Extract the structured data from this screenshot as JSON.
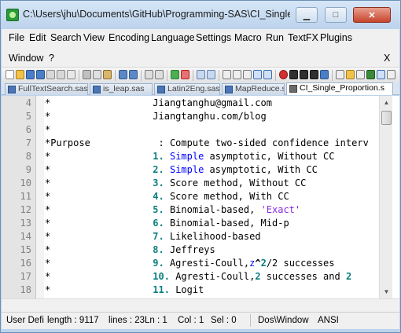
{
  "window": {
    "title": "C:\\Users\\jhu\\Documents\\GitHub\\Programming-SAS\\CI_Single_Propo...",
    "minimize_glyph": "▁",
    "maximize_glyph": "□",
    "close_glyph": "✕"
  },
  "menu": {
    "row1": [
      "File",
      "Edit",
      "Search",
      "View",
      "Encoding",
      "Language",
      "Settings",
      "Macro",
      "Run",
      "TextFX",
      "Plugins"
    ],
    "row2": [
      "Window",
      "?"
    ],
    "close_doc": "X"
  },
  "tabs": [
    {
      "label": "FullTextSearch.sas",
      "active": false
    },
    {
      "label": "is_leap.sas",
      "active": false
    },
    {
      "label": "Latin2Eng.sas",
      "active": false
    },
    {
      "label": "MapReduce.sas",
      "active": false
    },
    {
      "label": "CI_Single_Proportion.s",
      "active": true
    }
  ],
  "editor": {
    "lines": [
      {
        "n": "4",
        "segments": [
          {
            "t": "*                  Jiangtanghu@gmail.com",
            "c": ""
          }
        ]
      },
      {
        "n": "5",
        "segments": [
          {
            "t": "*                  Jiangtanghu.com/blog",
            "c": ""
          }
        ]
      },
      {
        "n": "6",
        "segments": [
          {
            "t": "*",
            "c": ""
          }
        ]
      },
      {
        "n": "7",
        "segments": [
          {
            "t": "*Purpose            : Compute two-sided confidence interv",
            "c": ""
          }
        ]
      },
      {
        "n": "8",
        "segments": [
          {
            "t": "*                  ",
            "c": ""
          },
          {
            "t": "1.",
            "c": "num"
          },
          {
            "t": " ",
            "c": ""
          },
          {
            "t": "Simple",
            "c": "kw"
          },
          {
            "t": " asymptotic, Without CC",
            "c": ""
          }
        ]
      },
      {
        "n": "9",
        "segments": [
          {
            "t": "*                  ",
            "c": ""
          },
          {
            "t": "2.",
            "c": "num"
          },
          {
            "t": " ",
            "c": ""
          },
          {
            "t": "Simple",
            "c": "kw"
          },
          {
            "t": " asymptotic, With CC",
            "c": ""
          }
        ]
      },
      {
        "n": "10",
        "segments": [
          {
            "t": "*                  ",
            "c": ""
          },
          {
            "t": "3.",
            "c": "num"
          },
          {
            "t": " Score method, Without CC",
            "c": ""
          }
        ]
      },
      {
        "n": "11",
        "segments": [
          {
            "t": "*                  ",
            "c": ""
          },
          {
            "t": "4.",
            "c": "num"
          },
          {
            "t": " Score method, With CC",
            "c": ""
          }
        ]
      },
      {
        "n": "12",
        "segments": [
          {
            "t": "*                  ",
            "c": ""
          },
          {
            "t": "5.",
            "c": "num"
          },
          {
            "t": " Binomial-based, ",
            "c": ""
          },
          {
            "t": "'Exact'",
            "c": "str"
          }
        ]
      },
      {
        "n": "13",
        "segments": [
          {
            "t": "*                  ",
            "c": ""
          },
          {
            "t": "6.",
            "c": "num"
          },
          {
            "t": " Binomial-based, Mid-p",
            "c": ""
          }
        ]
      },
      {
        "n": "14",
        "segments": [
          {
            "t": "*                  ",
            "c": ""
          },
          {
            "t": "7.",
            "c": "num"
          },
          {
            "t": " Likelihood-based",
            "c": ""
          }
        ]
      },
      {
        "n": "15",
        "segments": [
          {
            "t": "*                  ",
            "c": ""
          },
          {
            "t": "8.",
            "c": "num"
          },
          {
            "t": " Jeffreys",
            "c": ""
          }
        ]
      },
      {
        "n": "16",
        "segments": [
          {
            "t": "*                  ",
            "c": ""
          },
          {
            "t": "9.",
            "c": "num"
          },
          {
            "t": " Agresti-Coull,",
            "c": ""
          },
          {
            "t": "z",
            "c": "kw"
          },
          {
            "t": "^",
            "c": "op"
          },
          {
            "t": "2",
            "c": "num"
          },
          {
            "t": "/2 successes",
            "c": ""
          }
        ]
      },
      {
        "n": "17",
        "segments": [
          {
            "t": "*                  ",
            "c": ""
          },
          {
            "t": "10.",
            "c": "num"
          },
          {
            "t": " Agresti-Coull,",
            "c": ""
          },
          {
            "t": "2",
            "c": "num"
          },
          {
            "t": " successes and ",
            "c": ""
          },
          {
            "t": "2",
            "c": "num"
          }
        ]
      },
      {
        "n": "18",
        "segments": [
          {
            "t": "*                  ",
            "c": ""
          },
          {
            "t": "11.",
            "c": "num"
          },
          {
            "t": " Logit",
            "c": ""
          }
        ]
      }
    ]
  },
  "status": {
    "lang": "User Defi",
    "length": "length : 9117",
    "lines": "lines : 23",
    "ln": "Ln : 1",
    "col": "Col : 1",
    "sel": "Sel : 0",
    "eol": "Dos\\Window",
    "encoding": "ANSI"
  },
  "colors": {
    "keyword": "#0000ff",
    "number": "#0a7f7f",
    "string": "#8a2be2"
  }
}
